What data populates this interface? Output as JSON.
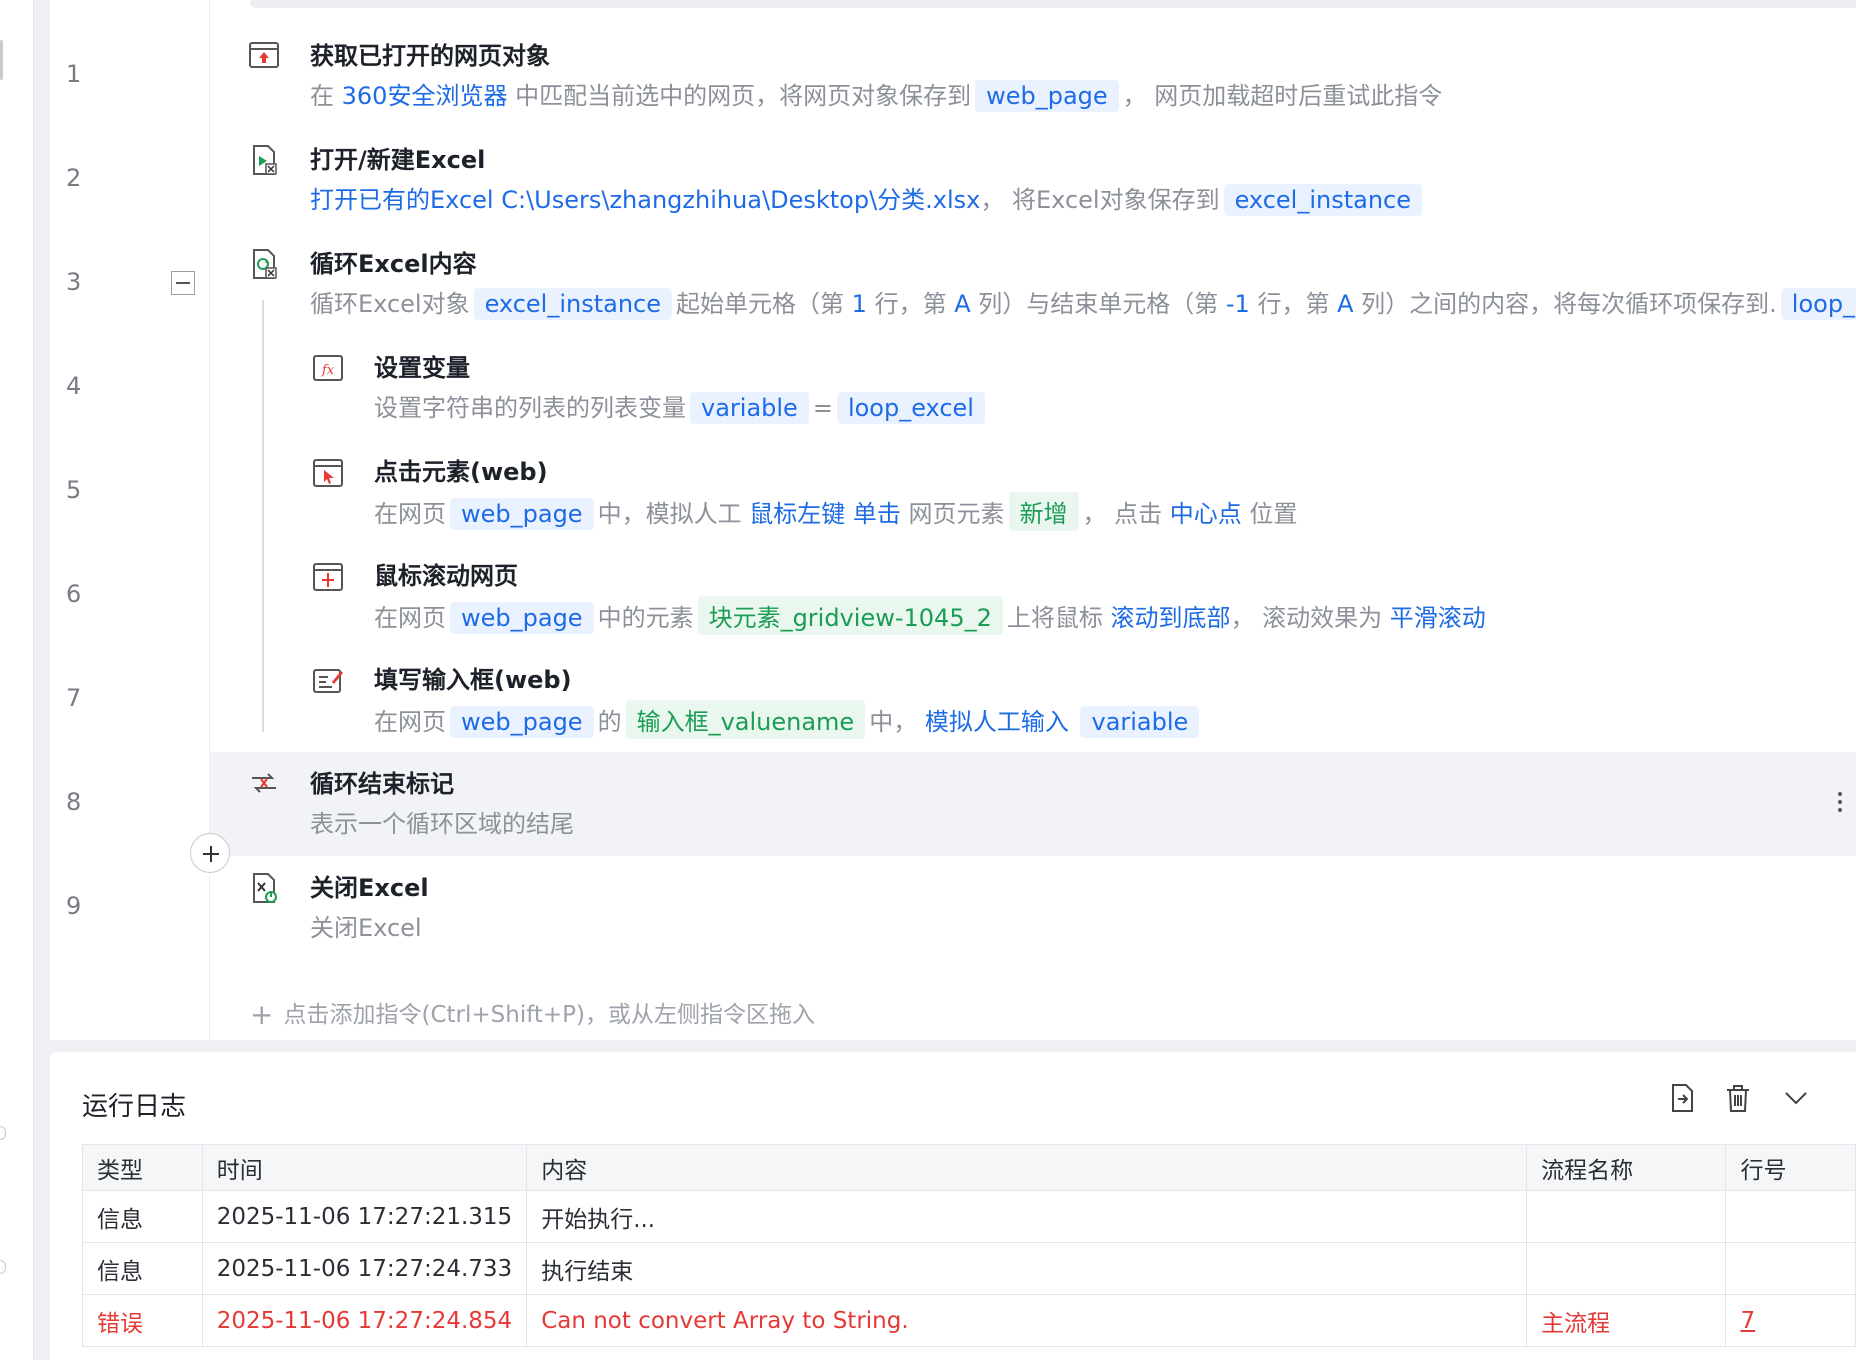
{
  "line_numbers": [
    "1",
    "2",
    "3",
    "4",
    "5",
    "6",
    "7",
    "8",
    "9"
  ],
  "steps": [
    {
      "title": "获取已打开的网页对象",
      "desc": [
        {
          "t": "在 "
        },
        {
          "t": "360安全浏览器",
          "k": "kw"
        },
        {
          "t": " 中匹配当前选中的网页，将网页对象保存到"
        },
        {
          "t": "web_page",
          "k": "tag"
        },
        {
          "t": "， 网页加载超时后重试此指令"
        }
      ]
    },
    {
      "title": "打开/新建Excel",
      "desc": [
        {
          "t": "打开已有的Excel",
          "k": "kw"
        },
        {
          "t": "  "
        },
        {
          "t": "C:\\Users\\zhangzhihua\\Desktop\\分类.xlsx",
          "k": "kw"
        },
        {
          "t": "， 将Excel对象保存到"
        },
        {
          "t": "excel_instance",
          "k": "tag"
        }
      ]
    },
    {
      "title": "循环Excel内容",
      "desc": [
        {
          "t": "循环Excel对象"
        },
        {
          "t": "excel_instance",
          "k": "tag"
        },
        {
          "t": "起始单元格（第 "
        },
        {
          "t": "1",
          "k": "kw"
        },
        {
          "t": " 行，第 "
        },
        {
          "t": "A",
          "k": "kw"
        },
        {
          "t": " 列）与结束单元格（第 "
        },
        {
          "t": "-1",
          "k": "kw"
        },
        {
          "t": " 行，第 "
        },
        {
          "t": "A",
          "k": "kw"
        },
        {
          "t": " 列）之间的内容，将每次循环项保存到."
        },
        {
          "t": "loop_iter",
          "k": "tag"
        }
      ]
    },
    {
      "title": "设置变量",
      "desc": [
        {
          "t": "设置字符串的列表的列表变量"
        },
        {
          "t": "variable",
          "k": "tag"
        },
        {
          "t": "="
        },
        {
          "t": "loop_excel",
          "k": "tag"
        }
      ]
    },
    {
      "title": "点击元素(web)",
      "desc": [
        {
          "t": "在网页"
        },
        {
          "t": "web_page",
          "k": "tag"
        },
        {
          "t": "中，模拟人工 "
        },
        {
          "t": "鼠标左键",
          "k": "kw"
        },
        {
          "t": " "
        },
        {
          "t": "单击",
          "k": "kw"
        },
        {
          "t": " 网页元素"
        },
        {
          "t": "新增",
          "k": "tag g"
        },
        {
          "t": "， 点击 "
        },
        {
          "t": "中心点",
          "k": "kw"
        },
        {
          "t": " 位置"
        }
      ]
    },
    {
      "title": "鼠标滚动网页",
      "desc": [
        {
          "t": "在网页"
        },
        {
          "t": "web_page",
          "k": "tag"
        },
        {
          "t": "中的元素"
        },
        {
          "t": "块元素_gridview-1045_2",
          "k": "tag g"
        },
        {
          "t": "上将鼠标 "
        },
        {
          "t": "滚动到底部",
          "k": "kw"
        },
        {
          "t": "， 滚动效果为 "
        },
        {
          "t": "平滑滚动",
          "k": "kw"
        }
      ]
    },
    {
      "title": "填写输入框(web)",
      "desc": [
        {
          "t": "在网页"
        },
        {
          "t": "web_page",
          "k": "tag"
        },
        {
          "t": "的"
        },
        {
          "t": "输入框_valuename",
          "k": "tag g"
        },
        {
          "t": "中， "
        },
        {
          "t": "模拟人工输入",
          "k": "kw"
        },
        {
          "t": " "
        },
        {
          "t": "variable",
          "k": "tag"
        }
      ]
    },
    {
      "title": "循环结束标记",
      "desc": [
        {
          "t": "表示一个循环区域的结尾"
        }
      ]
    },
    {
      "title": "关闭Excel",
      "desc": [
        {
          "t": "关闭Excel"
        }
      ]
    }
  ],
  "add_command_text": "点击添加指令(Ctrl+Shift+P)，或从左侧指令区拖入",
  "log": {
    "title": "运行日志",
    "columns": [
      "类型",
      "时间",
      "内容",
      "流程名称",
      "行号"
    ],
    "rows": [
      {
        "type": "信息",
        "time": "2025-11-06 17:27:21.315",
        "content": "开始执行...",
        "flow": "",
        "line": ""
      },
      {
        "type": "信息",
        "time": "2025-11-06 17:27:24.733",
        "content": "执行结束",
        "flow": "",
        "line": ""
      },
      {
        "type": "错误",
        "time": "2025-11-06 17:27:24.854",
        "content": "Can not convert Array to String.",
        "flow": "主流程",
        "line": "7"
      }
    ]
  },
  "colors": {
    "accent": "#1e6be6",
    "green": "#1b9d55",
    "error": "#e53935"
  },
  "icons": [
    "browser-page-icon",
    "excel-open-icon",
    "excel-loop-icon",
    "set-variable-icon",
    "click-element-icon",
    "scroll-page-icon",
    "fill-input-icon",
    "loop-end-icon",
    "excel-close-icon",
    "export-icon",
    "trash-icon",
    "chevron-down-icon"
  ]
}
